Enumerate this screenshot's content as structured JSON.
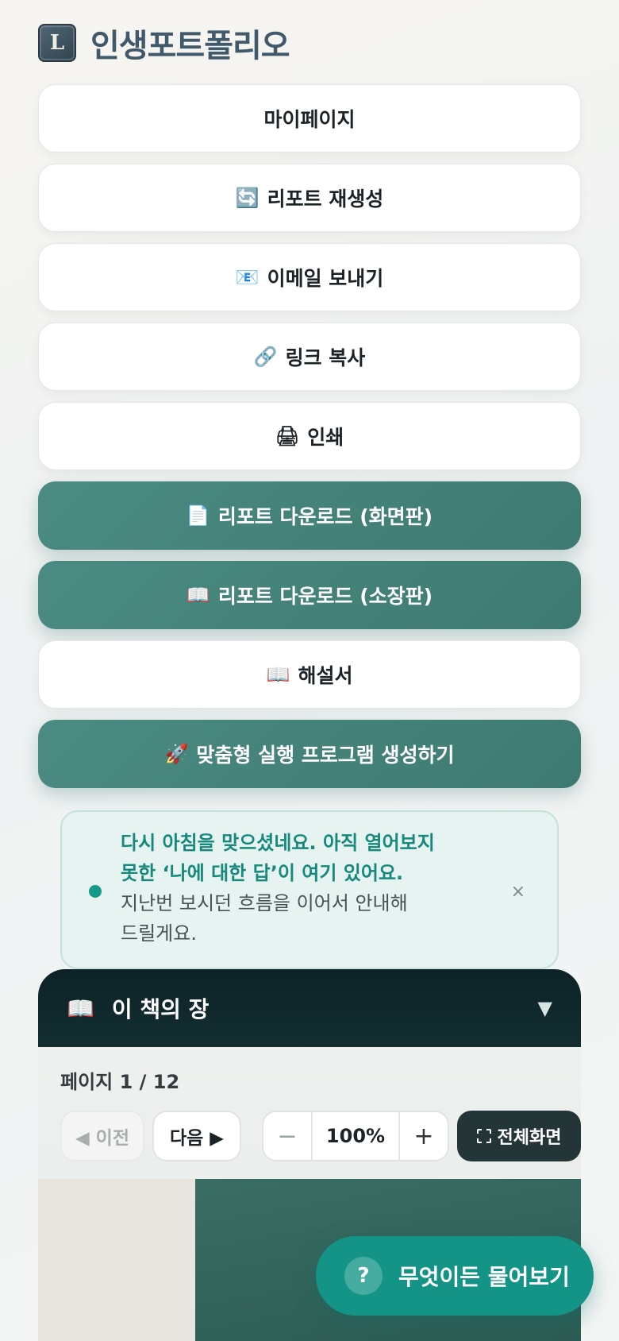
{
  "brand": {
    "logo_text": "L",
    "title": "인생포트폴리오"
  },
  "actions": [
    {
      "name": "mypage-button",
      "icon": "",
      "label": "마이페이지",
      "style": "light"
    },
    {
      "name": "regenerate-report-button",
      "icon": "🔄",
      "label": "리포트 재생성",
      "style": "light"
    },
    {
      "name": "send-email-button",
      "icon": "📧",
      "label": "이메일 보내기",
      "style": "light"
    },
    {
      "name": "copy-link-button",
      "icon": "🔗",
      "label": "링크 복사",
      "style": "light"
    },
    {
      "name": "print-button",
      "icon": "🖨",
      "label": "인쇄",
      "style": "light"
    },
    {
      "name": "download-screen-button",
      "icon": "📄",
      "label": "리포트 다운로드 (화면판)",
      "style": "teal"
    },
    {
      "name": "download-collector-button",
      "icon": "📖",
      "label": "리포트 다운로드 (소장판)",
      "style": "teal"
    },
    {
      "name": "guidebook-button",
      "icon": "📖",
      "label": "해설서",
      "style": "light"
    },
    {
      "name": "custom-program-button",
      "icon": "🚀",
      "label": "맞춤형 실행 프로그램 생성하기",
      "style": "teal"
    }
  ],
  "notice": {
    "line1": "다시 아침을 맞으셨네요. 아직 열어보지",
    "line2": "못한 ‘나에 대한 답’이 여기 있어요.",
    "line3": "지난번 보시던 흐름을 이어서 안내해",
    "line4": "드릴게요.",
    "close": "×"
  },
  "chapter": {
    "icon": "📖",
    "title": "이 책의 장",
    "toggle": "▼"
  },
  "viewer": {
    "page_indicator": "페이지 1 / 12",
    "prev_label": "◀ 이전",
    "next_label": "다음 ▶",
    "zoom_minus": "−",
    "zoom_value": "100%",
    "zoom_plus": "+",
    "fullscreen_label": "전체화면"
  },
  "ask": {
    "icon": "?",
    "label": "무엇이든 물어보기"
  },
  "colors": {
    "teal": "#3e7a71",
    "accent": "#139486",
    "brand_text": "#40596b",
    "dark": "#0d2226"
  }
}
